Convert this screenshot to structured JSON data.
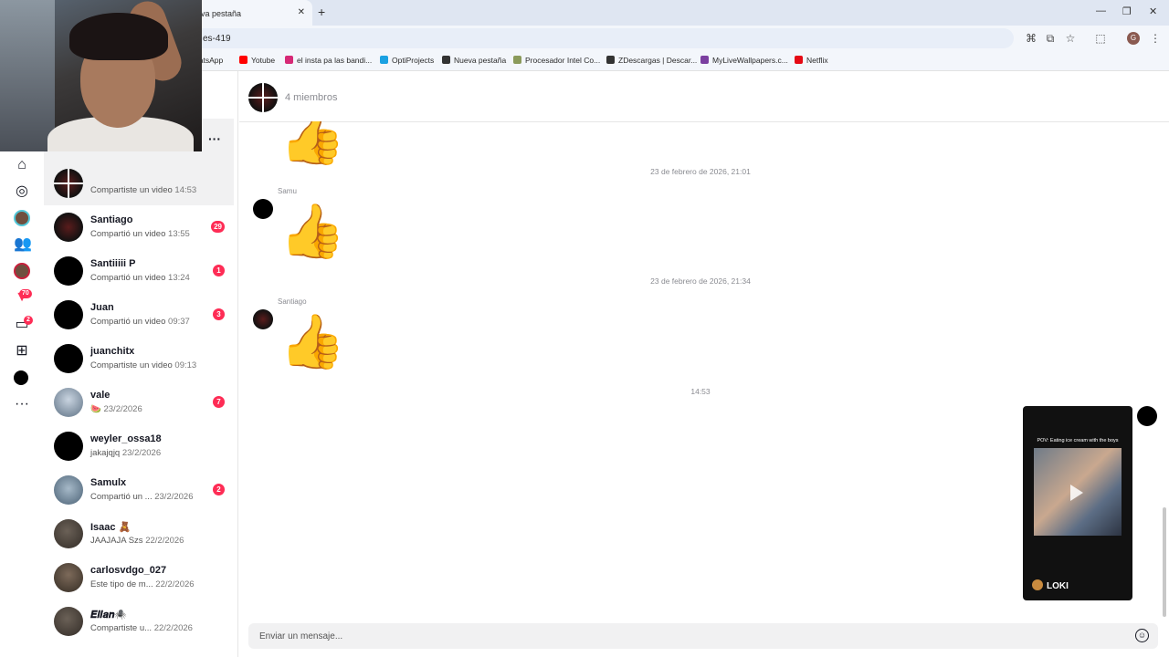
{
  "browser": {
    "tab_title": "va pestaña",
    "url": "es-419",
    "bookmarks": [
      {
        "label": "hatsApp",
        "color": "#25d366"
      },
      {
        "label": "Yotube",
        "color": "#ff0000"
      },
      {
        "label": "el insta pa las bandi...",
        "color": "#d62976"
      },
      {
        "label": "OptiProjects",
        "color": "#1ba1e2"
      },
      {
        "label": "Nueva pestaña",
        "color": "#333333"
      },
      {
        "label": "Procesador Intel Co...",
        "color": "#8a9a5b"
      },
      {
        "label": "ZDescargas | Descar...",
        "color": "#333333"
      },
      {
        "label": "MyLiveWallpapers.c...",
        "color": "#7b3fa0"
      },
      {
        "label": "Netflix",
        "color": "#e50914"
      }
    ],
    "profile_initial": "G"
  },
  "nav": {
    "inbox_badge": "70",
    "messages_badge": "2"
  },
  "conversations": [
    {
      "name": "",
      "preview": "Compartiste un video",
      "time": "14:53",
      "badge": "",
      "active": true,
      "avatar": "group"
    },
    {
      "name": "Santiago",
      "preview": "Compartió un video",
      "time": "13:55",
      "badge": "29",
      "avatar": "red"
    },
    {
      "name": "Santiiiii P",
      "preview": "Compartió un video",
      "time": "13:24",
      "badge": "1",
      "avatar": "black"
    },
    {
      "name": "Juan",
      "preview": "Compartió un video",
      "time": "09:37",
      "badge": "3",
      "avatar": "black"
    },
    {
      "name": "juanchitx",
      "preview": "Compartiste un video",
      "time": "09:13",
      "badge": "",
      "avatar": "black"
    },
    {
      "name": "vale",
      "preview": "🍉",
      "time": "23/2/2026",
      "badge": "7",
      "avatar": "photo1"
    },
    {
      "name": "weyler_ossa18",
      "preview": "jakajqjq",
      "time": "23/2/2026",
      "badge": "",
      "avatar": "black"
    },
    {
      "name": "Samulx",
      "preview": "Compartió un ...",
      "time": "23/2/2026",
      "badge": "2",
      "avatar": "photo2"
    },
    {
      "name": "Isaac 🧸",
      "preview": "JAAJAJA Szs",
      "time": "22/2/2026",
      "badge": "",
      "avatar": "photo3"
    },
    {
      "name": "carlosvdgo_027",
      "preview": "Este tipo de m...",
      "time": "22/2/2026",
      "badge": "",
      "avatar": "photo4"
    },
    {
      "name": "𝑬𝒍𝒊𝒂𝒏🕷️",
      "preview": "Compartiste u...",
      "time": "22/2/2026",
      "badge": "",
      "avatar": "photo3"
    }
  ],
  "chat": {
    "members": "4 miembros",
    "timestamps": [
      "23 de febrero de 2026, 21:01",
      "23 de febrero de 2026, 21:34",
      "14:53"
    ],
    "senders": [
      "Samu",
      "Santiago"
    ],
    "emoji": "👍",
    "video_caption": "POV: Eating ice cream with the boys",
    "video_user": "LOKI",
    "composer_placeholder": "Enviar un mensaje..."
  }
}
